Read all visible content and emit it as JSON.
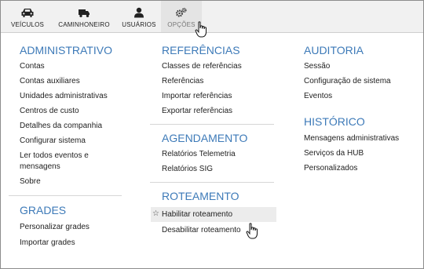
{
  "toolbar": {
    "buttons": [
      {
        "label": "VEÍCULOS",
        "icon": "car-icon"
      },
      {
        "label": "CAMINHONEIRO",
        "icon": "truck-icon"
      },
      {
        "label": "USUÁRIOS",
        "icon": "user-icon"
      },
      {
        "label": "OPÇÕES",
        "icon": "gears-icon",
        "active": true
      }
    ]
  },
  "menu": {
    "administrativo": {
      "title": "ADMINISTRATIVO",
      "items": [
        "Contas",
        "Contas auxiliares",
        "Unidades administrativas",
        "Centros de custo",
        "Detalhes da companhia",
        "Configurar sistema",
        "Ler todos eventos e",
        "mensagens",
        "Sobre"
      ]
    },
    "grades": {
      "title": "GRADES",
      "items": [
        "Personalizar grades",
        "Importar grades"
      ]
    },
    "referencias": {
      "title": "REFERÊNCIAS",
      "items": [
        "Classes de referências",
        "Referências",
        "Importar referências",
        "Exportar referências"
      ]
    },
    "agendamento": {
      "title": "AGENDAMENTO",
      "items": [
        "Relatórios Telemetria",
        "Relatórios SIG"
      ]
    },
    "roteamento": {
      "title": "ROTEAMENTO",
      "items": [
        "Habilitar roteamento",
        "Desabilitar roteamento"
      ]
    },
    "auditoria": {
      "title": "AUDITORIA",
      "items": [
        "Sessão",
        "Configuração de sistema",
        "Eventos"
      ]
    },
    "historico": {
      "title": "HISTÓRICO",
      "items": [
        "Mensagens administrativas",
        "Serviços da HUB",
        "Personalizados"
      ]
    }
  },
  "colors": {
    "accent": "#3d7ab8",
    "toolbar_bg": "#f1f1f1",
    "highlight": "#ececec"
  }
}
